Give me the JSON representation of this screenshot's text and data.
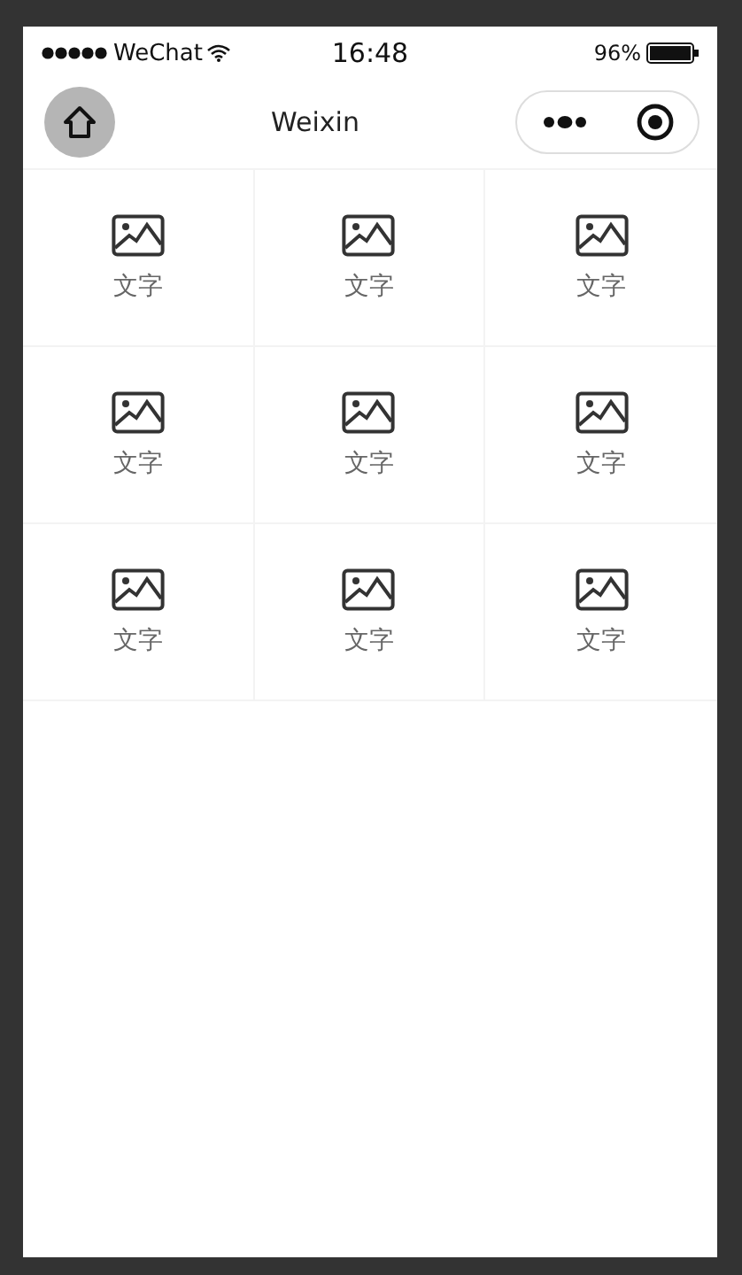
{
  "status_bar": {
    "carrier": "WeChat",
    "time": "16:48",
    "battery": "96%"
  },
  "nav_bar": {
    "title": "Weixin"
  },
  "grid": {
    "items": [
      {
        "label": "文字"
      },
      {
        "label": "文字"
      },
      {
        "label": "文字"
      },
      {
        "label": "文字"
      },
      {
        "label": "文字"
      },
      {
        "label": "文字"
      },
      {
        "label": "文字"
      },
      {
        "label": "文字"
      },
      {
        "label": "文字"
      }
    ]
  }
}
